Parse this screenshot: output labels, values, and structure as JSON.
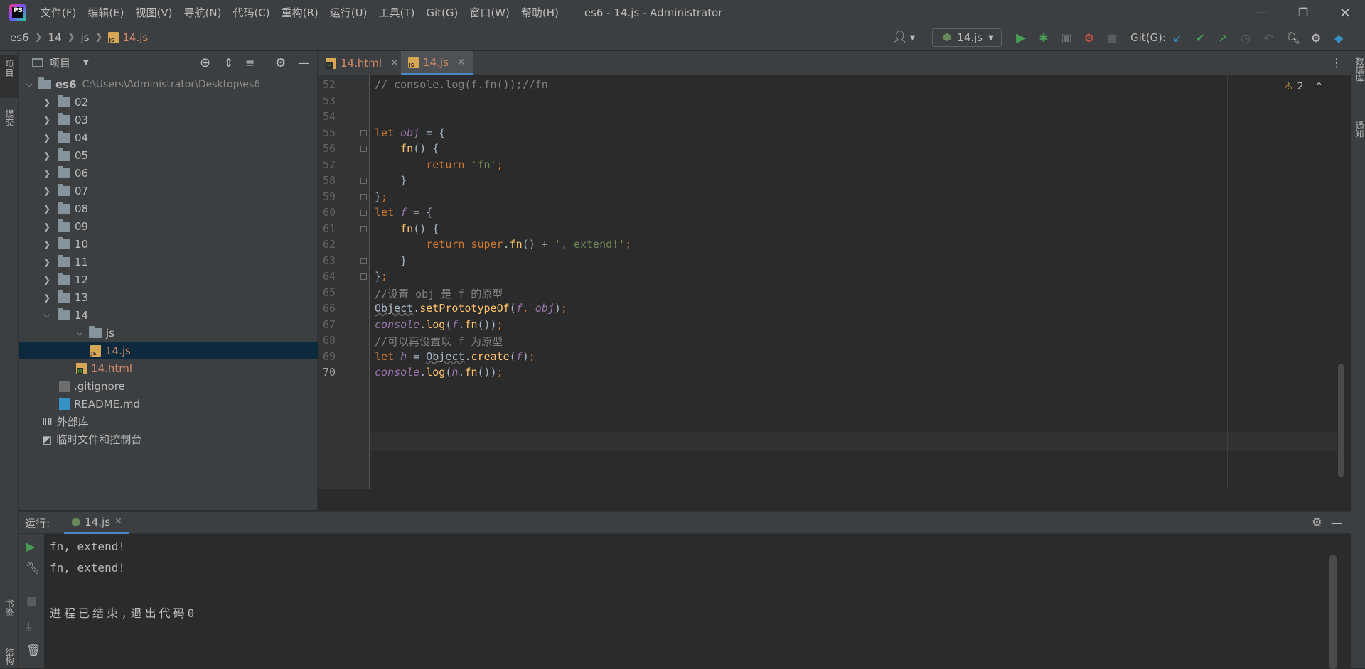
{
  "menu": [
    "文件(F)",
    "编辑(E)",
    "视图(V)",
    "导航(N)",
    "代码(C)",
    "重构(R)",
    "运行(U)",
    "工具(T)",
    "Git(G)",
    "窗口(W)",
    "帮助(H)"
  ],
  "window_title": "es6 - 14.js - Administrator",
  "breadcrumb": [
    "es6",
    "14",
    "js",
    "14.js"
  ],
  "run_config": "14.js",
  "git_label": "Git(G):",
  "left_strip": [
    "项目",
    "提交",
    "书签",
    "结构"
  ],
  "project": {
    "header": "项目",
    "root_name": "es6",
    "root_path": "C:\\Users\\Administrator\\Desktop\\es6",
    "folders": [
      "02",
      "03",
      "04",
      "05",
      "06",
      "07",
      "08",
      "09",
      "10",
      "11",
      "12",
      "13",
      "14"
    ],
    "subfolder": "js",
    "selected_file": "14.js",
    "html_file": "14.html",
    "gitignore": ".gitignore",
    "readme": "README.md",
    "external_libs": "外部库",
    "scratches": "临时文件和控制台"
  },
  "tabs": [
    {
      "label": "14.html",
      "active": false
    },
    {
      "label": "14.js",
      "active": true
    }
  ],
  "inspections": "2",
  "editor": {
    "current_line": "70",
    "lines": [
      {
        "n": "52",
        "code": "// console.log(f.fn());//fn"
      },
      {
        "n": "53",
        "code": ""
      },
      {
        "n": "54",
        "code": ""
      },
      {
        "n": "55",
        "code": "let obj = {"
      },
      {
        "n": "56",
        "code": "    fn() {"
      },
      {
        "n": "57",
        "code": "        return 'fn';"
      },
      {
        "n": "58",
        "code": "    }"
      },
      {
        "n": "59",
        "code": "};"
      },
      {
        "n": "60",
        "code": "let f = {"
      },
      {
        "n": "61",
        "code": "    fn() {"
      },
      {
        "n": "62",
        "code": "        return super.fn() + ', extend!';"
      },
      {
        "n": "63",
        "code": "    }"
      },
      {
        "n": "64",
        "code": "};"
      },
      {
        "n": "65",
        "code": "//设置 obj 是 f 的原型"
      },
      {
        "n": "66",
        "code": "Object.setPrototypeOf(f, obj);"
      },
      {
        "n": "67",
        "code": "console.log(f.fn());"
      },
      {
        "n": "68",
        "code": "//可以再设置以 f 为原型"
      },
      {
        "n": "69",
        "code": "let h = Object.create(f);"
      },
      {
        "n": "70",
        "code": "console.log(h.fn());"
      }
    ]
  },
  "run": {
    "label": "运行:",
    "tab": "14.js",
    "output": [
      "fn, extend!",
      "fn, extend!",
      "",
      "进程已结束,退出代码0"
    ]
  },
  "right_strip": [
    "数据库",
    "通知"
  ],
  "colors": {
    "keyword": "#cc7832",
    "string": "#6a8759",
    "comment": "#808080",
    "variable": "#9876aa",
    "function": "#ffc66d",
    "selection": "#0d293e"
  }
}
